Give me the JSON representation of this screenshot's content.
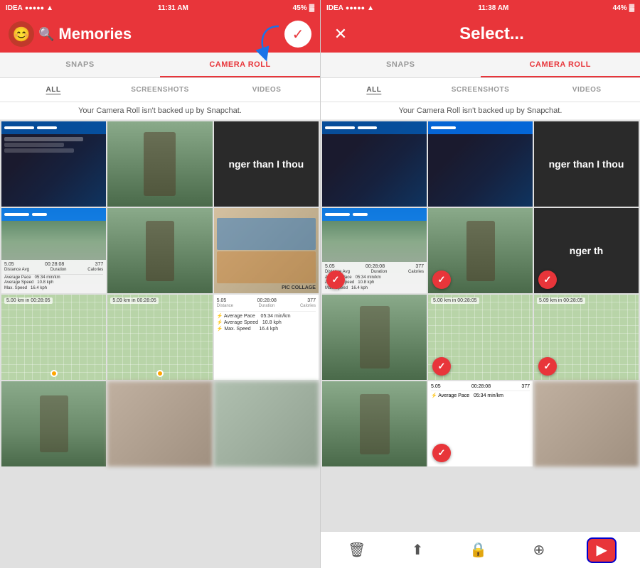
{
  "panels": [
    {
      "id": "left",
      "statusBar": {
        "carrier": "IDEA",
        "time": "11:31 AM",
        "battery": "45%",
        "signal": 4,
        "wifi": true
      },
      "header": {
        "type": "memories",
        "title": "Memories",
        "hasAvatar": true,
        "hasCheck": true
      },
      "tabsPrimary": [
        "SNAPS",
        "CAMERA ROLL"
      ],
      "activePrimaryTab": 1,
      "tabsSecondary": [
        "ALL",
        "SCREENSHOTS",
        "VIDEOS"
      ],
      "activeSecondaryTab": 0,
      "notice": "Your Camera Roll isn't backed up by Snapchat.",
      "hasArrow": true
    },
    {
      "id": "right",
      "statusBar": {
        "carrier": "IDEA",
        "time": "11:38 AM",
        "battery": "44%",
        "signal": 4,
        "wifi": true
      },
      "header": {
        "type": "select",
        "title": "Select...",
        "hasClose": true
      },
      "tabsPrimary": [
        "SNAPS",
        "CAMERA ROLL"
      ],
      "activePrimaryTab": 1,
      "tabsSecondary": [
        "ALL",
        "SCREENSHOTS",
        "VIDEOS"
      ],
      "activeSecondaryTab": 0,
      "notice": "Your Camera Roll isn't backed up by Snapchat.",
      "hasToolbar": true,
      "toolbar": {
        "delete": "🗑",
        "share": "⬆",
        "lock": "🔒",
        "addCircle": "⊕",
        "send": "▶"
      }
    }
  ],
  "photos": {
    "left": [
      {
        "id": 1,
        "type": "screenshot",
        "checked": false
      },
      {
        "id": 2,
        "type": "person",
        "checked": false
      },
      {
        "id": 3,
        "type": "text",
        "text": "nger than I thou",
        "checked": false
      },
      {
        "id": 4,
        "type": "stats",
        "checked": false
      },
      {
        "id": 5,
        "type": "person",
        "checked": false
      },
      {
        "id": 6,
        "type": "pic-collage",
        "checked": false
      },
      {
        "id": 7,
        "type": "person",
        "checked": false
      },
      {
        "id": 8,
        "type": "stats",
        "checked": false
      },
      {
        "id": 9,
        "type": "stats",
        "checked": false
      },
      {
        "id": 10,
        "type": "person",
        "checked": false
      },
      {
        "id": 11,
        "type": "blurred",
        "checked": false
      },
      {
        "id": 12,
        "type": "blurred",
        "checked": false
      }
    ],
    "right": [
      {
        "id": 1,
        "type": "screenshot",
        "checked": false
      },
      {
        "id": 2,
        "type": "screenshot2",
        "checked": false
      },
      {
        "id": 3,
        "type": "text",
        "text": "nger than I thou",
        "checked": false
      },
      {
        "id": 4,
        "type": "stats",
        "checked": true
      },
      {
        "id": 5,
        "type": "person",
        "checked": true
      },
      {
        "id": 6,
        "type": "text2",
        "text": "nger th",
        "checked": true
      },
      {
        "id": 7,
        "type": "person",
        "checked": false
      },
      {
        "id": 8,
        "type": "stats",
        "checked": true
      },
      {
        "id": 9,
        "type": "stats2",
        "checked": true
      },
      {
        "id": 10,
        "type": "person",
        "checked": false
      },
      {
        "id": 11,
        "type": "stats3",
        "checked": true
      },
      {
        "id": 12,
        "type": "blurred",
        "checked": false
      }
    ]
  },
  "accent": "#e8353a",
  "labels": {
    "snaps": "SNAPS",
    "cameraRoll": "CAMERA ROLL",
    "all": "ALL",
    "screenshots": "SCREENSHOTS",
    "videos": "VIDEOS",
    "notice": "Your Camera Roll isn't backed up by Snapchat.",
    "memories": "Memories",
    "select": "Select...",
    "ngerText": "nger than I thou"
  }
}
